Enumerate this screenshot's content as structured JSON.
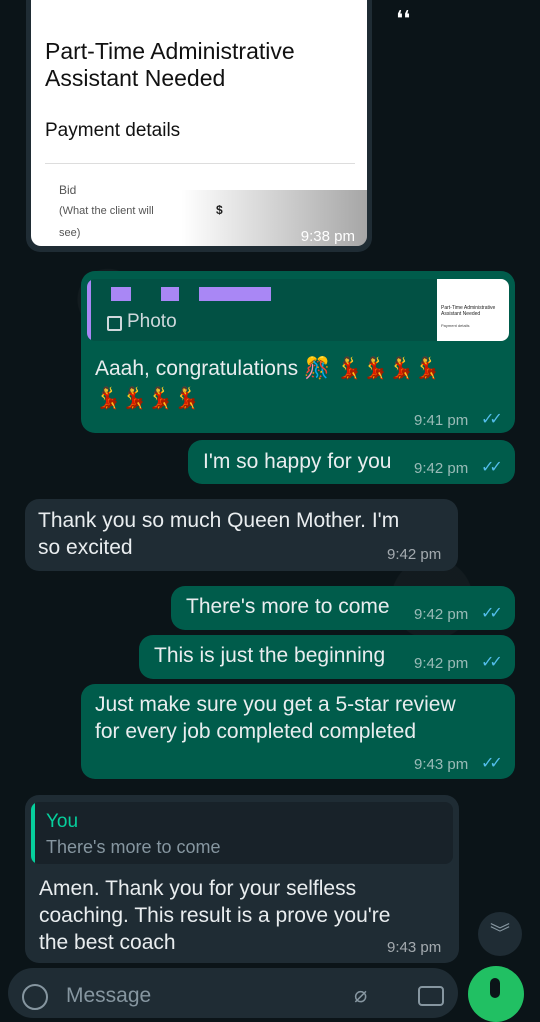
{
  "screenshot_card": {
    "title_line1": "Part-Time Administrative",
    "title_line2": "Assistant Needed",
    "section": "Payment details",
    "bid_label": "Bid",
    "bid_sub1": "(What the client will",
    "bid_sub2": "see)",
    "amount": "$",
    "time": "9:38 pm"
  },
  "photo_reply": {
    "label": "Photo",
    "thumb_title": "Part-Time Administrative Assistant Needed",
    "thumb_section": "Payment details"
  },
  "messages": [
    {
      "line1": "Aaah, congratulations 🎊 💃💃💃💃",
      "line2": "💃💃💃💃",
      "time": "9:41 pm"
    },
    {
      "text": "I'm so happy for you",
      "time": "9:42 pm"
    },
    {
      "line1": "Thank you so much Queen Mother. I'm",
      "line2": "so excited",
      "time": "9:42 pm"
    },
    {
      "text": "There's more to come",
      "time": "9:42 pm"
    },
    {
      "text": "This is just the beginning",
      "time": "9:42 pm"
    },
    {
      "line1": "Just make sure you get a 5-star review",
      "line2": "for every job completed completed",
      "time": "9:43 pm"
    },
    {
      "quote_author": "You",
      "quote_text": "There's more to come",
      "line1": "Amen. Thank you for your selfless",
      "line2": "coaching. This result is a prove you're",
      "line3": "the best coach",
      "time": "9:43 pm"
    }
  ],
  "ticks": "✓✓",
  "input": {
    "placeholder": "Message"
  },
  "colors": {
    "incoming": "#1f2c34",
    "outgoing": "#005c4b",
    "read_ticks": "#53bdeb",
    "quote_bar": "#06cf9c",
    "fab": "#21c063"
  }
}
